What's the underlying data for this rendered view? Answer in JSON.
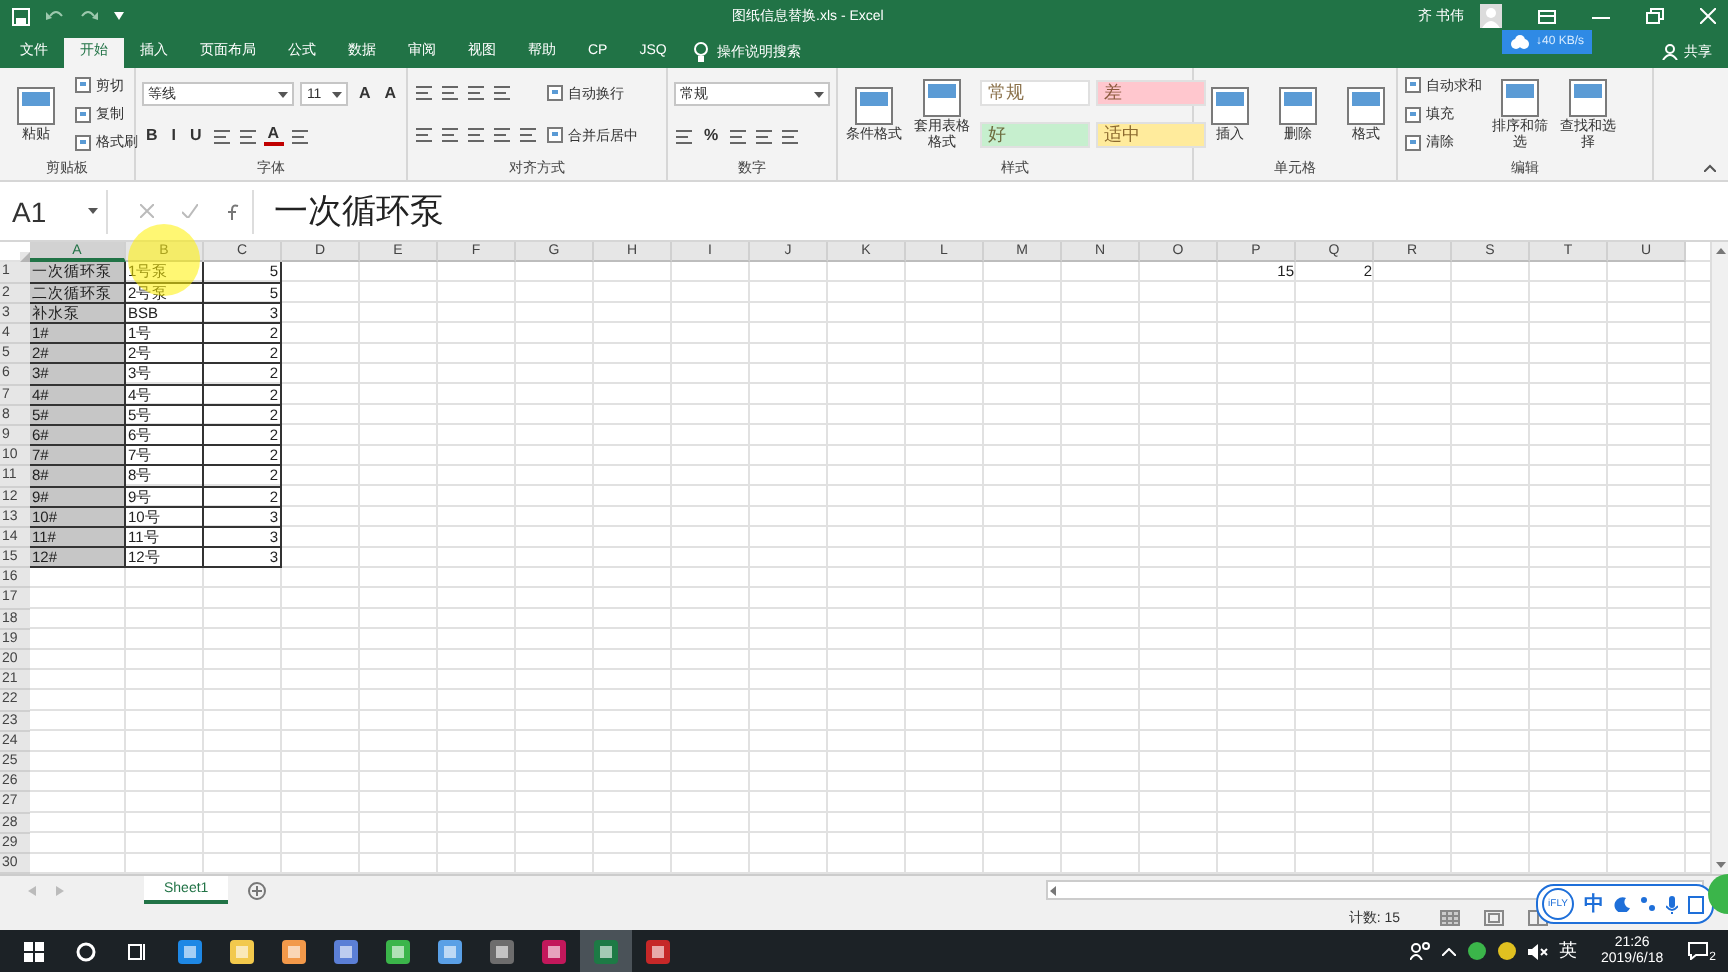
{
  "window": {
    "title": "图纸信息替换.xls - Excel",
    "user": "齐 书伟",
    "net_speed": "↓40 KB/s"
  },
  "tabs": [
    {
      "label": "文件",
      "selected": false
    },
    {
      "label": "开始",
      "selected": true
    },
    {
      "label": "插入",
      "selected": false
    },
    {
      "label": "页面布局",
      "selected": false
    },
    {
      "label": "公式",
      "selected": false
    },
    {
      "label": "数据",
      "selected": false
    },
    {
      "label": "审阅",
      "selected": false
    },
    {
      "label": "视图",
      "selected": false
    },
    {
      "label": "帮助",
      "selected": false
    },
    {
      "label": "CP",
      "selected": false
    },
    {
      "label": "JSQ",
      "selected": false
    }
  ],
  "tell_me": "操作说明搜索",
  "share": "共享",
  "ribbon": [
    {
      "title": "剪贴板",
      "columns": [
        [
          [
            {
              "kind": "big",
              "label": "粘贴"
            }
          ]
        ],
        [
          [
            {
              "kind": "small",
              "label": "剪切"
            }
          ],
          [
            {
              "kind": "small",
              "label": "复制"
            }
          ],
          [
            {
              "kind": "small",
              "label": "格式刷"
            }
          ]
        ]
      ]
    },
    {
      "title": "字体",
      "columns": [
        [
          [
            {
              "kind": "field",
              "value": "等线"
            },
            {
              "kind": "field",
              "value": "11"
            },
            {
              "kind": "glyph",
              "label": "A"
            },
            {
              "kind": "glyph",
              "label": "A"
            }
          ],
          [
            {
              "kind": "glyph",
              "label": "B"
            },
            {
              "kind": "glyph",
              "label": "I"
            },
            {
              "kind": "glyph",
              "label": "U"
            },
            {
              "kind": "icon"
            },
            {
              "kind": "icon"
            },
            {
              "kind": "colorglyph",
              "label": "A",
              "color": "#c00000"
            },
            {
              "kind": "icon"
            }
          ]
        ]
      ]
    },
    {
      "title": "对齐方式",
      "columns": [
        [
          [
            {
              "kind": "icon"
            },
            {
              "kind": "icon"
            },
            {
              "kind": "icon"
            },
            {
              "kind": "icon"
            }
          ],
          [
            {
              "kind": "icon"
            },
            {
              "kind": "icon"
            },
            {
              "kind": "icon"
            },
            {
              "kind": "icon"
            },
            {
              "kind": "icon"
            }
          ]
        ],
        [
          [
            {
              "kind": "small",
              "label": "自动换行"
            }
          ],
          [
            {
              "kind": "small",
              "label": "合并后居中"
            }
          ]
        ]
      ]
    },
    {
      "title": "数字",
      "columns": [
        [
          [
            {
              "kind": "field",
              "value": "常规"
            }
          ],
          [
            {
              "kind": "icon"
            },
            {
              "kind": "glyph",
              "label": "%"
            },
            {
              "kind": "icon"
            },
            {
              "kind": "icon"
            },
            {
              "kind": "icon"
            }
          ]
        ]
      ]
    },
    {
      "title": "样式",
      "columns": [
        [
          [
            {
              "kind": "big",
              "label": "条件格式"
            }
          ]
        ],
        [
          [
            {
              "kind": "big",
              "label": "套用表格格式"
            }
          ]
        ],
        [
          [
            {
              "kind": "style",
              "label": "常规",
              "color": "#ffffff"
            },
            {
              "kind": "style",
              "label": "差",
              "color": "#ffc7ce"
            }
          ],
          [
            {
              "kind": "style",
              "label": "好",
              "color": "#c6efce"
            },
            {
              "kind": "style",
              "label": "适中",
              "color": "#ffeb9c"
            }
          ]
        ]
      ]
    },
    {
      "title": "单元格",
      "columns": [
        [
          [
            {
              "kind": "big",
              "label": "插入"
            }
          ]
        ],
        [
          [
            {
              "kind": "big",
              "label": "删除"
            }
          ]
        ],
        [
          [
            {
              "kind": "big",
              "label": "格式"
            }
          ]
        ]
      ]
    },
    {
      "title": "编辑",
      "columns": [
        [
          [
            {
              "kind": "small",
              "label": "自动求和"
            }
          ],
          [
            {
              "kind": "small",
              "label": "填充"
            }
          ],
          [
            {
              "kind": "small",
              "label": "清除"
            }
          ]
        ],
        [
          [
            {
              "kind": "big",
              "label": "排序和筛选"
            }
          ]
        ],
        [
          [
            {
              "kind": "big",
              "label": "查找和选择"
            }
          ]
        ]
      ]
    }
  ],
  "name_box": "A1",
  "formula": "一次循环泵",
  "columns": [
    {
      "label": "A",
      "selected": true
    },
    {
      "label": "B",
      "selected": false
    },
    {
      "label": "C",
      "selected": false
    },
    {
      "label": "D",
      "selected": false
    },
    {
      "label": "E",
      "selected": false
    },
    {
      "label": "F",
      "selected": false
    },
    {
      "label": "G",
      "selected": false
    },
    {
      "label": "H",
      "selected": false
    },
    {
      "label": "I",
      "selected": false
    },
    {
      "label": "J",
      "selected": false
    },
    {
      "label": "K",
      "selected": false
    },
    {
      "label": "L",
      "selected": false
    },
    {
      "label": "M",
      "selected": false
    },
    {
      "label": "N",
      "selected": false
    },
    {
      "label": "O",
      "selected": false
    },
    {
      "label": "P",
      "selected": false
    },
    {
      "label": "Q",
      "selected": false
    },
    {
      "label": "R",
      "selected": false
    },
    {
      "label": "S",
      "selected": false
    },
    {
      "label": "T",
      "selected": false
    },
    {
      "label": "U",
      "selected": false
    }
  ],
  "rows": [
    {
      "label": "1",
      "cells": [
        "一次循环泵",
        "1号泵",
        "5",
        null,
        null,
        null,
        null,
        null,
        null,
        null,
        null,
        null,
        null,
        null,
        null,
        "15",
        "2"
      ]
    },
    {
      "label": "2",
      "cells": [
        "二次循环泵",
        "2号泵",
        "5"
      ]
    },
    {
      "label": "3",
      "cells": [
        "补水泵",
        "BSB",
        "3"
      ]
    },
    {
      "label": "4",
      "cells": [
        "1#",
        "1号",
        "2"
      ]
    },
    {
      "label": "5",
      "cells": [
        "2#",
        "2号",
        "2"
      ]
    },
    {
      "label": "6",
      "cells": [
        "3#",
        "3号",
        "2"
      ]
    },
    {
      "label": "7",
      "cells": [
        "4#",
        "4号",
        "2"
      ]
    },
    {
      "label": "8",
      "cells": [
        "5#",
        "5号",
        "2"
      ]
    },
    {
      "label": "9",
      "cells": [
        "6#",
        "6号",
        "2"
      ]
    },
    {
      "label": "10",
      "cells": [
        "7#",
        "7号",
        "2"
      ]
    },
    {
      "label": "11",
      "cells": [
        "8#",
        "8号",
        "2"
      ]
    },
    {
      "label": "12",
      "cells": [
        "9#",
        "9号",
        "2"
      ]
    },
    {
      "label": "13",
      "cells": [
        "10#",
        "10号",
        "3"
      ]
    },
    {
      "label": "14",
      "cells": [
        "11#",
        "11号",
        "3"
      ]
    },
    {
      "label": "15",
      "cells": [
        "12#",
        "12号",
        "3"
      ]
    },
    {
      "label": "16",
      "cells": []
    },
    {
      "label": "17",
      "cells": []
    },
    {
      "label": "18",
      "cells": []
    },
    {
      "label": "19",
      "cells": []
    },
    {
      "label": "20",
      "cells": []
    },
    {
      "label": "21",
      "cells": []
    },
    {
      "label": "22",
      "cells": []
    },
    {
      "label": "23",
      "cells": []
    },
    {
      "label": "24",
      "cells": []
    },
    {
      "label": "25",
      "cells": []
    },
    {
      "label": "26",
      "cells": []
    },
    {
      "label": "27",
      "cells": []
    },
    {
      "label": "28",
      "cells": []
    },
    {
      "label": "29",
      "cells": []
    },
    {
      "label": "30",
      "cells": []
    }
  ],
  "sheets": [
    {
      "label": "Sheet1",
      "selected": true
    }
  ],
  "status": {
    "count": "计数: 15"
  },
  "ime_bar": {
    "logo": "iFLY",
    "mode": "中"
  },
  "taskbar": {
    "apps": [
      {
        "active": false
      },
      {
        "active": false
      },
      {
        "active": false
      },
      {
        "active": false
      },
      {
        "active": false
      },
      {
        "active": false
      },
      {
        "active": false
      },
      {
        "active": false
      },
      {
        "active": true
      },
      {
        "active": false
      }
    ],
    "language": "英",
    "time": "21:26",
    "date": "2019/6/18",
    "notifications": "2"
  }
}
